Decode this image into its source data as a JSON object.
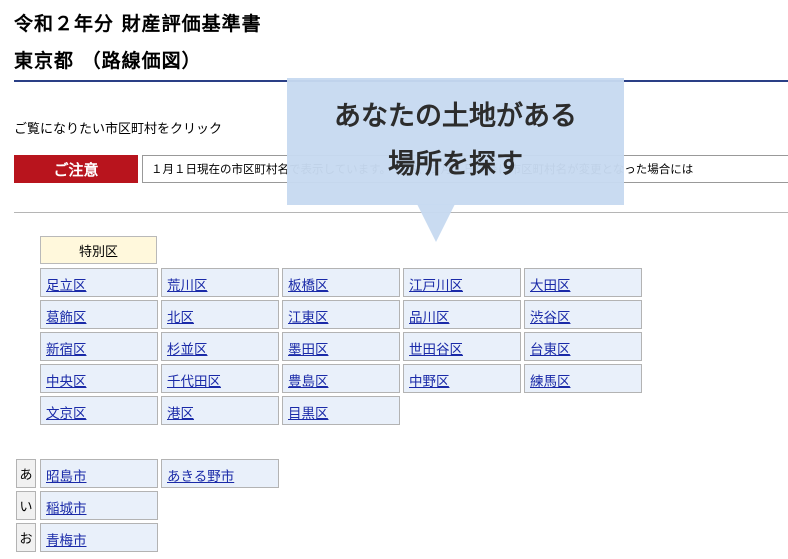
{
  "header": {
    "title_line1": "令和２年分 財産評価基準書",
    "title_line2": "東京都 （路線価図）"
  },
  "intro": "ご覧になりたい市区町村をクリック",
  "notice": {
    "label": "ご注意",
    "text": "１月１日現在の市区町村名で表示しています。 なお、１月１日以降に市区町村名が変更となった場合には"
  },
  "callout": {
    "line1": "あなたの土地がある",
    "line2": "場所を探す",
    "color": "#c7daf0"
  },
  "wards": {
    "header": "特別区",
    "items": [
      "足立区",
      "荒川区",
      "板橋区",
      "江戸川区",
      "大田区",
      "葛飾区",
      "北区",
      "江東区",
      "品川区",
      "渋谷区",
      "新宿区",
      "杉並区",
      "墨田区",
      "世田谷区",
      "台東区",
      "中央区",
      "千代田区",
      "豊島区",
      "中野区",
      "練馬区",
      "文京区",
      "港区",
      "目黒区"
    ]
  },
  "cities": [
    {
      "kana": "あ",
      "items": [
        "昭島市",
        "あきる野市"
      ]
    },
    {
      "kana": "い",
      "items": [
        "稲城市"
      ]
    },
    {
      "kana": "お",
      "items": [
        "青梅市"
      ]
    }
  ],
  "colors": {
    "accent_red": "#b8141d",
    "rule_blue": "#2a3f86",
    "link": "#1a2aa8",
    "cell_bg": "#e9f0fa",
    "ward_header_bg": "#fff8dc"
  }
}
